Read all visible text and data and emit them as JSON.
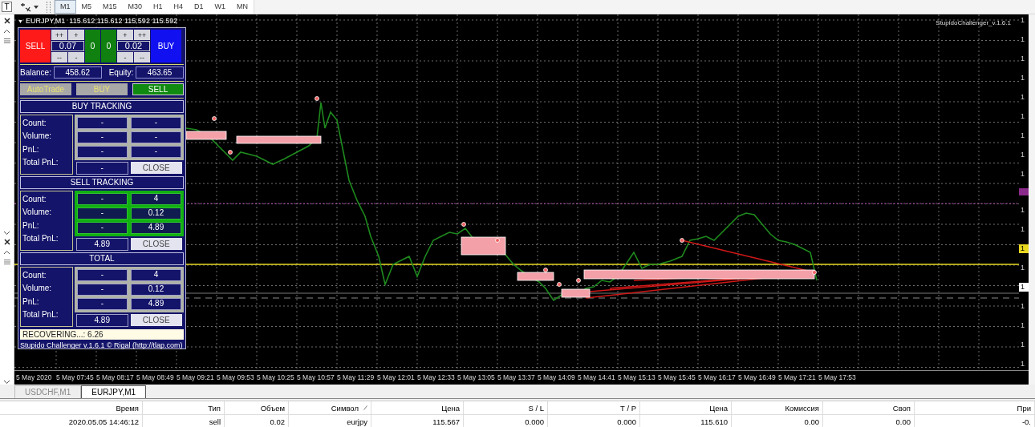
{
  "toolbar": {
    "text_tool": "T",
    "timeframes": [
      {
        "label": "M1",
        "selected": true
      },
      {
        "label": "M5",
        "selected": false
      },
      {
        "label": "M15",
        "selected": false
      },
      {
        "label": "M30",
        "selected": false
      },
      {
        "label": "H1",
        "selected": false
      },
      {
        "label": "H4",
        "selected": false
      },
      {
        "label": "D1",
        "selected": false
      },
      {
        "label": "W1",
        "selected": false
      },
      {
        "label": "MN",
        "selected": false
      }
    ]
  },
  "chart": {
    "caret": "▼",
    "title": "EURJPY,M1  115.612 115.612 115.592 115.592",
    "indicator_label": "StupidoChallenger_v.1.6.1",
    "price_axis": [
      {
        "kind": "tick",
        "label": "1"
      },
      {
        "kind": "tick",
        "label": "1"
      },
      {
        "kind": "tick",
        "label": "1"
      },
      {
        "kind": "tick",
        "label": "1"
      },
      {
        "kind": "tick",
        "label": "1"
      },
      {
        "kind": "tick",
        "label": "1"
      },
      {
        "kind": "tick",
        "label": "1"
      },
      {
        "kind": "tick",
        "label": "1"
      },
      {
        "kind": "tick",
        "label": "1"
      },
      {
        "kind": "level"
      },
      {
        "kind": "tick",
        "label": "1"
      },
      {
        "kind": "tick",
        "label": "1"
      },
      {
        "kind": "bid",
        "label": "1"
      },
      {
        "kind": "tick",
        "label": "1"
      },
      {
        "kind": "ask",
        "label": "1"
      },
      {
        "kind": "tick",
        "label": "1"
      },
      {
        "kind": "tick",
        "label": "1"
      },
      {
        "kind": "tick",
        "label": "1"
      },
      {
        "kind": "tick",
        "label": "1"
      }
    ],
    "time_axis": [
      "5 May 2020",
      "5 May 07:45",
      "5 May 08:17",
      "5 May 08:49",
      "5 May 09:21",
      "5 May 09:53",
      "5 May 10:25",
      "5 May 10:57",
      "5 May 11:29",
      "5 May 12:01",
      "5 May 12:33",
      "5 May 13:05",
      "5 May 13:37",
      "5 May 14:09",
      "5 May 14:41",
      "5 May 15:13",
      "5 May 15:45",
      "5 May 16:17",
      "5 May 16:49",
      "5 May 17:21",
      "5 May 17:53"
    ]
  },
  "panel": {
    "sell_button": "SELL",
    "buy_button": "BUY",
    "sell_lot": {
      "plus2": "++",
      "plus": "+",
      "value": "0.07",
      "minus2": "--",
      "minus": "-"
    },
    "sell_count": "0",
    "buy_count": "0",
    "buy_lot": {
      "plus": "+",
      "plus2": "++",
      "value": "0.02",
      "minus": "-",
      "minus2": "--"
    },
    "balance_label": "Balance:",
    "balance": "458.62",
    "equity_label": "Equity:",
    "equity": "463.65",
    "modes": [
      {
        "label": "AutoTrade",
        "selected": false
      },
      {
        "label": "BUY",
        "selected": false
      },
      {
        "label": "SELL",
        "selected": true
      }
    ],
    "sections": [
      {
        "title": "BUY TRACKING",
        "active": false,
        "rows": [
          {
            "label": "Count:",
            "values": [
              "-",
              "-"
            ]
          },
          {
            "label": "Volume:",
            "values": [
              "-",
              "-"
            ]
          },
          {
            "label": "PnL:",
            "values": [
              "-",
              "-"
            ]
          }
        ],
        "total_label": "Total PnL:",
        "total": "-",
        "close": "CLOSE"
      },
      {
        "title": "SELL TRACKING",
        "active": true,
        "rows": [
          {
            "label": "Count:",
            "values": [
              "-",
              "4"
            ]
          },
          {
            "label": "Volume:",
            "values": [
              "-",
              "0.12"
            ]
          },
          {
            "label": "PnL:",
            "values": [
              "-",
              "4.89"
            ]
          }
        ],
        "total_label": "Total PnL:",
        "total": "4.89",
        "close": "CLOSE"
      },
      {
        "title": "TOTAL",
        "active": false,
        "rows": [
          {
            "label": "Count:",
            "values": [
              "-",
              "4"
            ]
          },
          {
            "label": "Volume:",
            "values": [
              "-",
              "0.12"
            ]
          },
          {
            "label": "PnL:",
            "values": [
              "-",
              "4.89"
            ]
          }
        ],
        "total_label": "Total PnL:",
        "total": "4.89",
        "close": "CLOSE"
      }
    ],
    "status": "RECOVERING...: 6.26",
    "footer": "Stupido Challenger v.1.6.1 © Rigal (http://tlap.com)"
  },
  "chart_tabs": [
    {
      "label": "USDCHF,M1",
      "selected": false
    },
    {
      "label": "EURJPY,M1",
      "selected": true
    }
  ],
  "orders_table": {
    "columns": [
      {
        "label": "Время",
        "sorted": false
      },
      {
        "label": "Тип",
        "sorted": false
      },
      {
        "label": "Объем",
        "sorted": false
      },
      {
        "label": "Символ",
        "sorted": true
      },
      {
        "label": "Цена",
        "sorted": false
      },
      {
        "label": "S / L",
        "sorted": false
      },
      {
        "label": "T / P",
        "sorted": false
      },
      {
        "label": "Цена",
        "sorted": false
      },
      {
        "label": "Комиссия",
        "sorted": false
      },
      {
        "label": "Своп",
        "sorted": false
      },
      {
        "label": "При",
        "sorted": false
      }
    ],
    "rows": [
      [
        "2020.05.05 14:46:12",
        "sell",
        "0.02",
        "eurjpy",
        "115.567",
        "0.000",
        "0.000",
        "115.610",
        "0.00",
        "0.00",
        "-0."
      ]
    ]
  }
}
